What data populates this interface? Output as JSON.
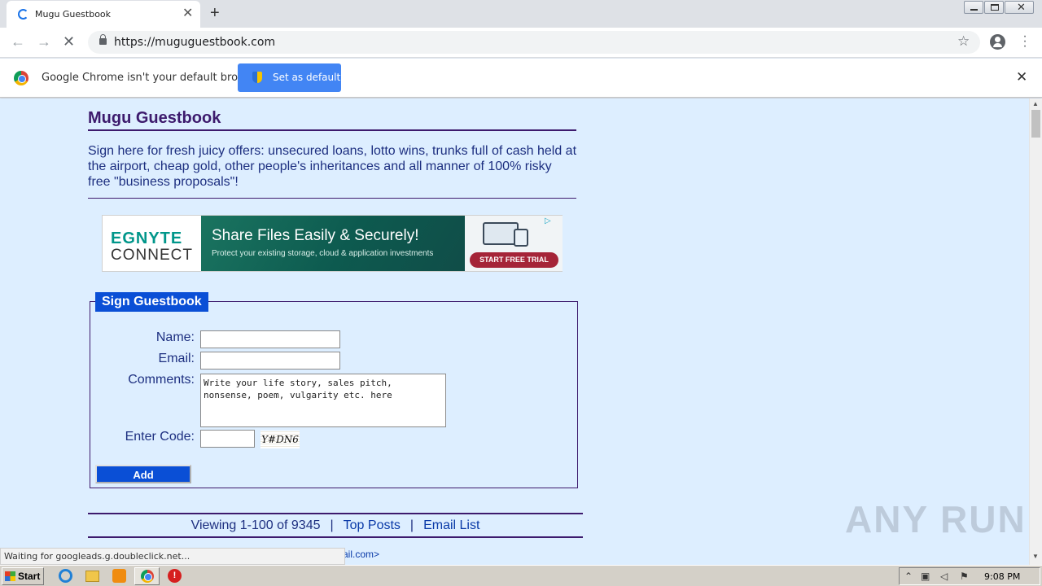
{
  "browser": {
    "tab_title": "Mugu Guestbook",
    "new_tab": "+",
    "url": "https://muguguestbook.com",
    "infobar_text": "Google Chrome isn't your default browser",
    "set_default_label": "Set as default",
    "status_text": "Waiting for googleads.g.doubleclick.net..."
  },
  "page": {
    "title": "Mugu Guestbook",
    "intro": "Sign here for fresh juicy offers: unsecured loans, lotto wins, trunks full of cash held at the airport, cheap gold, other people's inheritances and all manner of 100% risky free \"business proposals\"!",
    "ad": {
      "logo_top": "EGNYTE",
      "logo_bottom": "CONNECT",
      "headline": "Share Files Easily & Securely!",
      "subline": "Protect your existing storage, cloud & application investments",
      "cta": "START FREE TRIAL"
    },
    "form": {
      "legend": "Sign Guestbook",
      "name_label": "Name:",
      "email_label": "Email:",
      "comments_label": "Comments:",
      "comments_value": "Write your life story, sales pitch,\nnonsense, poem, vulgarity etc. here",
      "code_label": "Enter Code:",
      "captcha_text": "Y#DN6",
      "add_label": "Add"
    },
    "pager": {
      "viewing": "Viewing 1-100 of 9345",
      "top_posts": "Top Posts",
      "email_list": "Email List",
      "separator": "|"
    },
    "email_snippet": "ail.com>"
  },
  "watermark": "ANY RUN",
  "taskbar": {
    "start_label": "Start",
    "clock": "9:08 PM"
  },
  "colors": {
    "page_bg": "#ddeeff",
    "heading": "#3d1a6d",
    "text": "#1d2f80",
    "accent_blue": "#0a4fd6"
  }
}
